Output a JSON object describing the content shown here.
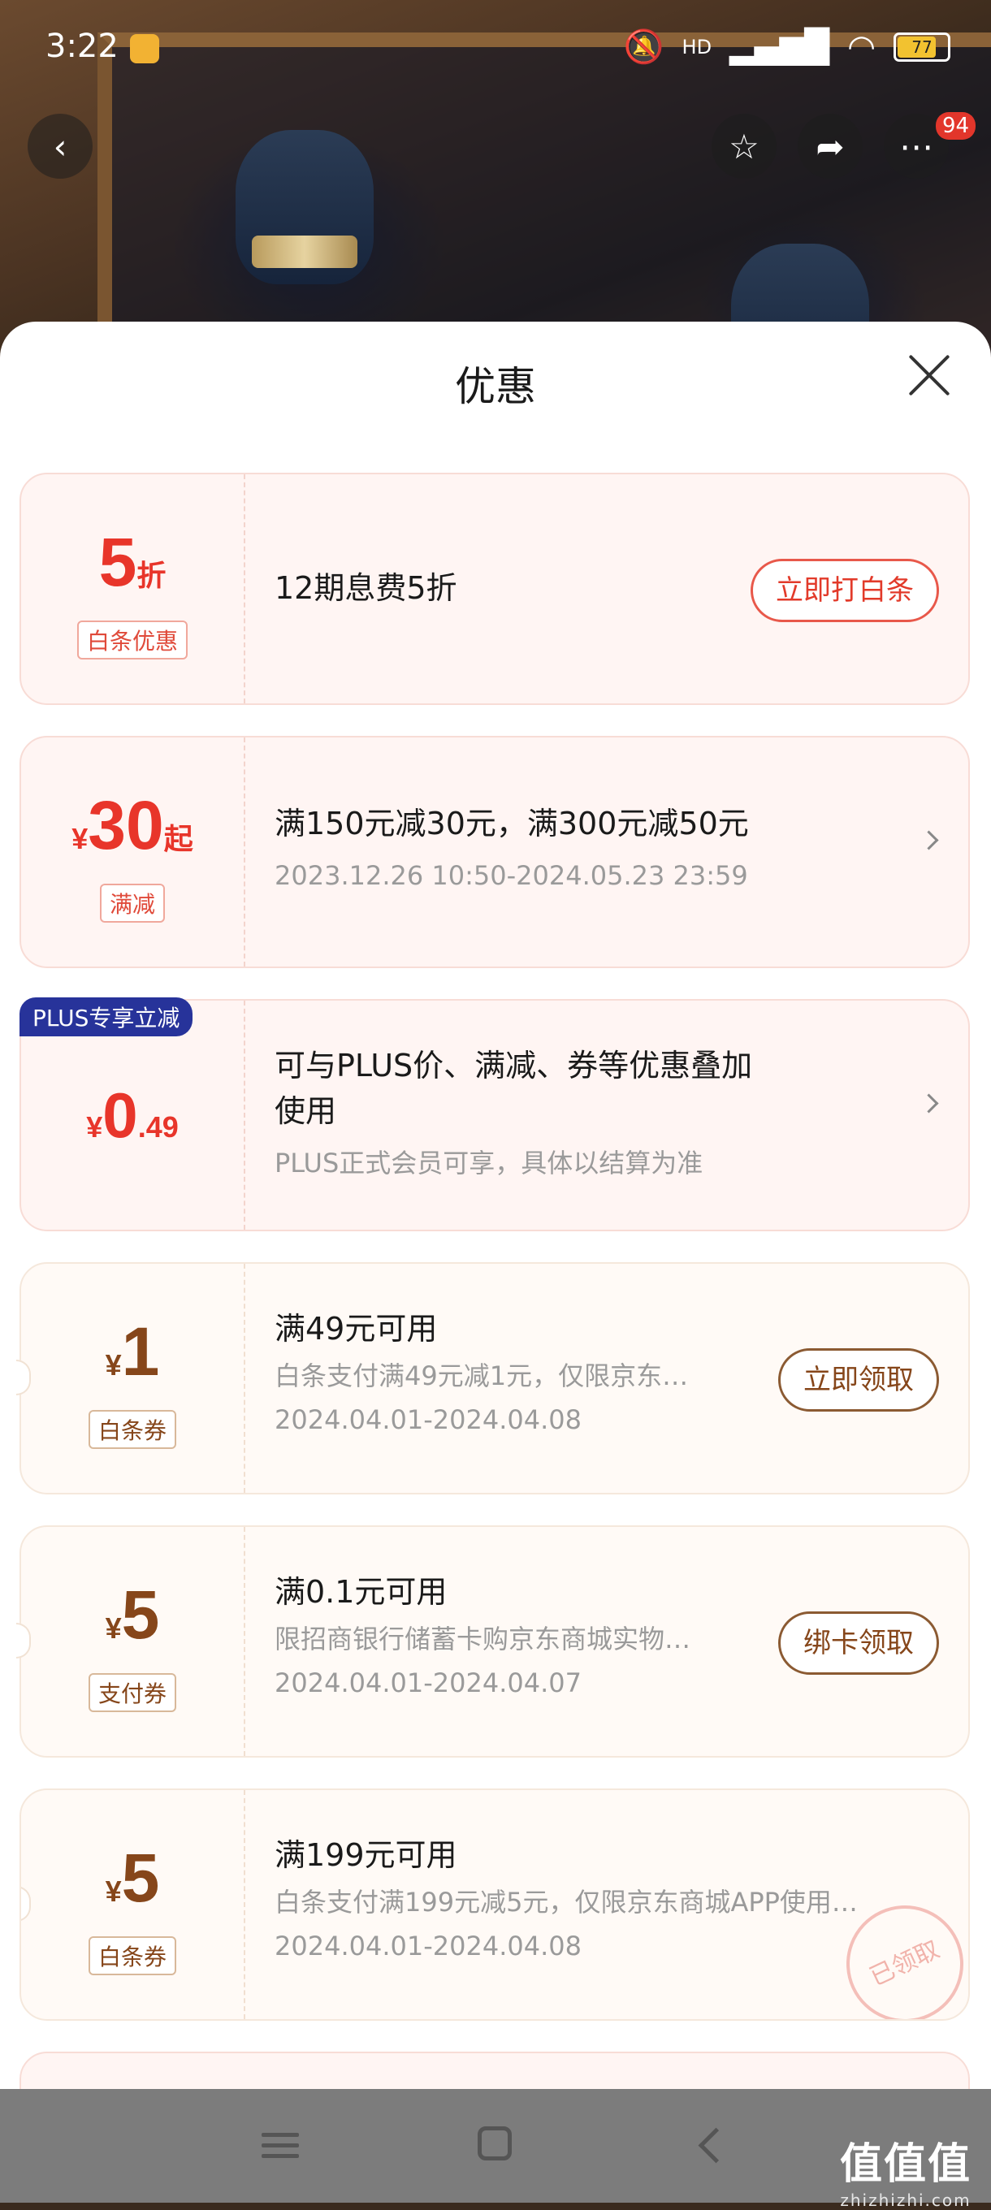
{
  "status_bar": {
    "time": "3:22",
    "battery": "77",
    "network": "HD"
  },
  "header": {
    "more_badge": "94"
  },
  "sheet": {
    "title": "优惠"
  },
  "offers": [
    {
      "amount_prefix": "",
      "amount_main": "5",
      "amount_suffix": "折",
      "tag": "白条优惠",
      "title": "12期息费5折",
      "button": "立即打白条"
    },
    {
      "amount_prefix": "¥",
      "amount_main": "30",
      "amount_suffix": "起",
      "tag": "满减",
      "title": "满150元减30元，满300元减50元",
      "subtitle": "2023.12.26 10:50-2024.05.23 23:59"
    },
    {
      "badge": "PLUS专享立减",
      "amount_prefix": "¥",
      "amount_main": "0",
      "amount_suffix": ".49",
      "title_line1": "可与PLUS价、满减、券等优惠叠加",
      "title_line2": "使用",
      "subtitle": "PLUS正式会员可享，具体以结算为准"
    }
  ],
  "coupons": [
    {
      "amount_prefix": "¥",
      "amount_main": "1",
      "tag": "白条券",
      "title": "满49元可用",
      "desc": "白条支付满49元减1元，仅限京东…",
      "date": "2024.04.01-2024.04.08",
      "button": "立即领取"
    },
    {
      "amount_prefix": "¥",
      "amount_main": "5",
      "tag": "支付券",
      "title": "满0.1元可用",
      "desc": "限招商银行储蓄卡购京东商城实物…",
      "date": "2024.04.01-2024.04.07",
      "button": "绑卡领取"
    },
    {
      "amount_prefix": "¥",
      "amount_main": "5",
      "tag": "白条券",
      "title": "满199元可用",
      "desc": "白条支付满199元减5元，仅限京东商城APP使用…",
      "date": "2024.04.01-2024.04.08",
      "stamp": "已领取"
    }
  ],
  "watermark": {
    "brand": "值值值",
    "site": "zhizhizhi.com"
  },
  "colors": {
    "accent_red": "#e8352a",
    "coupon_brown": "#86461a",
    "plus_blue": "#27339a"
  }
}
